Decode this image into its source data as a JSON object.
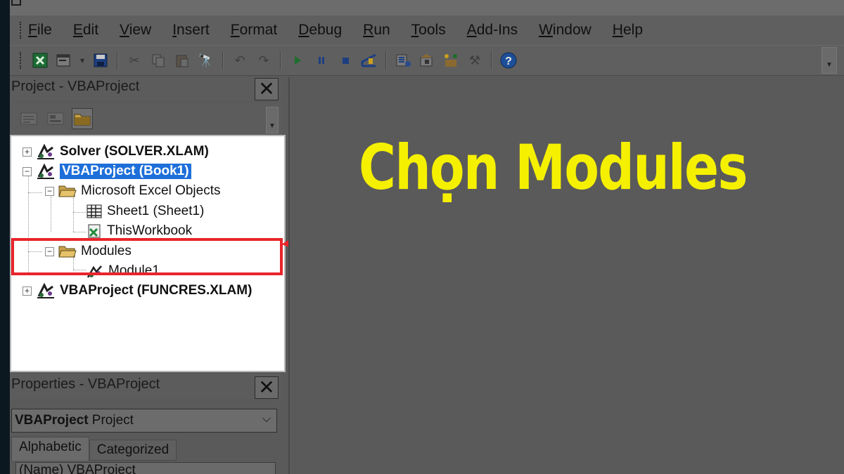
{
  "menubar": {
    "items": [
      {
        "mnemonic": "F",
        "rest": "ile"
      },
      {
        "mnemonic": "E",
        "rest": "dit"
      },
      {
        "mnemonic": "V",
        "rest": "iew"
      },
      {
        "mnemonic": "I",
        "rest": "nsert"
      },
      {
        "mnemonic": "F",
        "rest": "ormat"
      },
      {
        "mnemonic": "D",
        "rest": "ebug"
      },
      {
        "mnemonic": "R",
        "rest": "un"
      },
      {
        "mnemonic": "T",
        "rest": "ools"
      },
      {
        "mnemonic": "A",
        "rest": "dd-Ins"
      },
      {
        "mnemonic": "W",
        "rest": "indow"
      },
      {
        "mnemonic": "H",
        "rest": "elp"
      }
    ]
  },
  "project_pane": {
    "title": "Project - VBAProject",
    "close": "✕"
  },
  "tree": {
    "solver": "Solver (SOLVER.XLAM)",
    "book1": "VBAProject (Book1)",
    "excel_objects": "Microsoft Excel Objects",
    "sheet1": "Sheet1 (Sheet1)",
    "thisworkbook": "ThisWorkbook",
    "modules": "Modules",
    "module1": "Module1",
    "funcres": "VBAProject (FUNCRES.XLAM)",
    "plus": "+",
    "minus": "−"
  },
  "properties_pane": {
    "title": "Properties - VBAProject",
    "close": "✕",
    "object_bold": "VBAProject",
    "object_type": " Project",
    "chevron": "⌵",
    "tabs": {
      "alphabetic": "Alphabetic",
      "categorized": "Categorized"
    },
    "grid_row": "(Name)  VBAProject"
  },
  "annotation": {
    "headline": "Chọn Modules",
    "highlight_color": "#e8252b",
    "headline_color": "#f5f000"
  },
  "icons": [
    "excel-icon",
    "userform-icon",
    "save-icon",
    "cut-icon",
    "copy-icon",
    "paste-icon",
    "find-icon",
    "undo-icon",
    "redo-icon",
    "run-icon",
    "break-icon",
    "reset-icon",
    "design-mode-icon",
    "project-explorer-icon",
    "properties-icon",
    "object-browser-icon",
    "toolbox-icon",
    "help-icon"
  ]
}
